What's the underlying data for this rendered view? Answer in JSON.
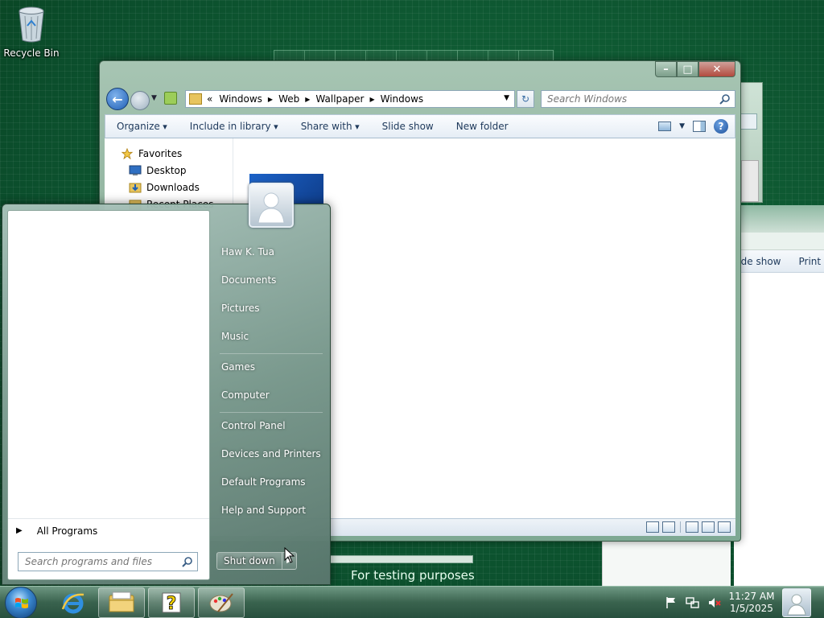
{
  "desktop": {
    "recycle_bin_label": "Recycle Bin",
    "watermark_text": "For testing purposes o"
  },
  "explorer": {
    "address": {
      "overflow": "«",
      "crumbs": [
        "Windows",
        "Web",
        "Wallpaper",
        "Windows"
      ]
    },
    "search_placeholder": "Search Windows",
    "toolbar": {
      "organize": "Organize",
      "include_in_library": "Include in library",
      "share_with": "Share with",
      "slide_show": "Slide show",
      "new_folder": "New folder"
    },
    "nav": {
      "favorites": "Favorites",
      "desktop": "Desktop",
      "downloads": "Downloads",
      "recent_places": "Recent Places"
    }
  },
  "background_window": {
    "slide_show": "lide show",
    "print": "Print"
  },
  "start_menu": {
    "user_name": "Haw K. Tua",
    "links": {
      "documents": "Documents",
      "pictures": "Pictures",
      "music": "Music",
      "games": "Games",
      "computer": "Computer",
      "control_panel": "Control Panel",
      "devices_and_printers": "Devices and Printers",
      "default_programs": "Default Programs",
      "help_and_support": "Help and Support"
    },
    "all_programs": "All Programs",
    "search_placeholder": "Search programs and files",
    "shutdown": "Shut down"
  },
  "taskbar": {
    "pinned": [
      "internet-explorer",
      "windows-explorer",
      "help-app",
      "paint"
    ],
    "clock_time": "11:27 AM",
    "clock_date": "1/5/2025"
  }
}
